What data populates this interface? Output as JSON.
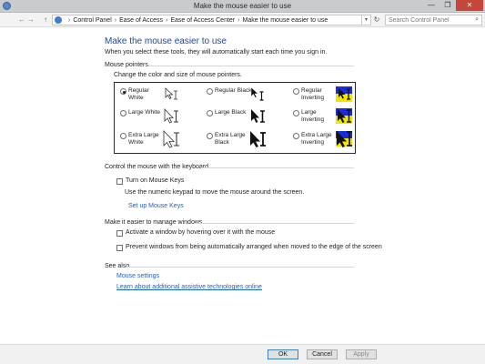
{
  "window": {
    "title": "Make the mouse easier to use",
    "minimize_glyph": "—",
    "maximize_glyph": "❐",
    "close_glyph": "✕"
  },
  "address": {
    "back_glyph": "←",
    "forward_glyph": "→",
    "up_glyph": "↑",
    "breadcrumbs": [
      "Control Panel",
      "Ease of Access",
      "Ease of Access Center",
      "Make the mouse easier to use"
    ],
    "separator": "›",
    "dropdown_glyph": "▾",
    "refresh_glyph": "↻",
    "search_placeholder": "Search Control Panel",
    "search_icon_glyph": "⌕"
  },
  "page": {
    "title": "Make the mouse easier to use",
    "description": "When you select these tools, they will automatically start each time you sign in."
  },
  "mouse_pointers": {
    "heading": "Mouse pointers",
    "subheading": "Change the color and size of mouse pointers.",
    "options": [
      {
        "label": "Regular White",
        "style": "white",
        "size": "regular",
        "selected": true
      },
      {
        "label": "Regular Black",
        "style": "black",
        "size": "regular",
        "selected": false
      },
      {
        "label": "Regular Inverting",
        "style": "inverting",
        "size": "regular",
        "selected": false
      },
      {
        "label": "Large White",
        "style": "white",
        "size": "large",
        "selected": false
      },
      {
        "label": "Large Black",
        "style": "black",
        "size": "large",
        "selected": false
      },
      {
        "label": "Large Inverting",
        "style": "inverting",
        "size": "large",
        "selected": false
      },
      {
        "label": "Extra Large White",
        "style": "white",
        "size": "xlarge",
        "selected": false
      },
      {
        "label": "Extra Large Black",
        "style": "black",
        "size": "xlarge",
        "selected": false
      },
      {
        "label": "Extra Large Inverting",
        "style": "inverting",
        "size": "xlarge",
        "selected": false
      }
    ]
  },
  "keyboard": {
    "heading": "Control the mouse with the keyboard",
    "mouse_keys_label": "Turn on Mouse Keys",
    "mouse_keys_checked": false,
    "mouse_keys_desc": "Use the numeric keypad to move the mouse around the screen.",
    "setup_link": "Set up Mouse Keys"
  },
  "windows": {
    "heading": "Make it easier to manage windows",
    "hover_activate_label": "Activate a window by hovering over it with the mouse",
    "hover_activate_checked": false,
    "prevent_arrange_label": "Prevent windows from being automatically arranged when moved to the edge of the screen",
    "prevent_arrange_checked": false
  },
  "see_also": {
    "heading": "See also",
    "mouse_settings_link": "Mouse settings",
    "assistive_link": "Learn about additional assistive technologies online"
  },
  "buttons": {
    "ok": "OK",
    "cancel": "Cancel",
    "apply": "Apply"
  },
  "colors": {
    "title_blue": "#1f4aa0",
    "link_blue": "#1f5fbf",
    "close_red": "#c7463a",
    "inverting_blue": "#1a2bd8",
    "inverting_yellow": "#f2e500"
  }
}
